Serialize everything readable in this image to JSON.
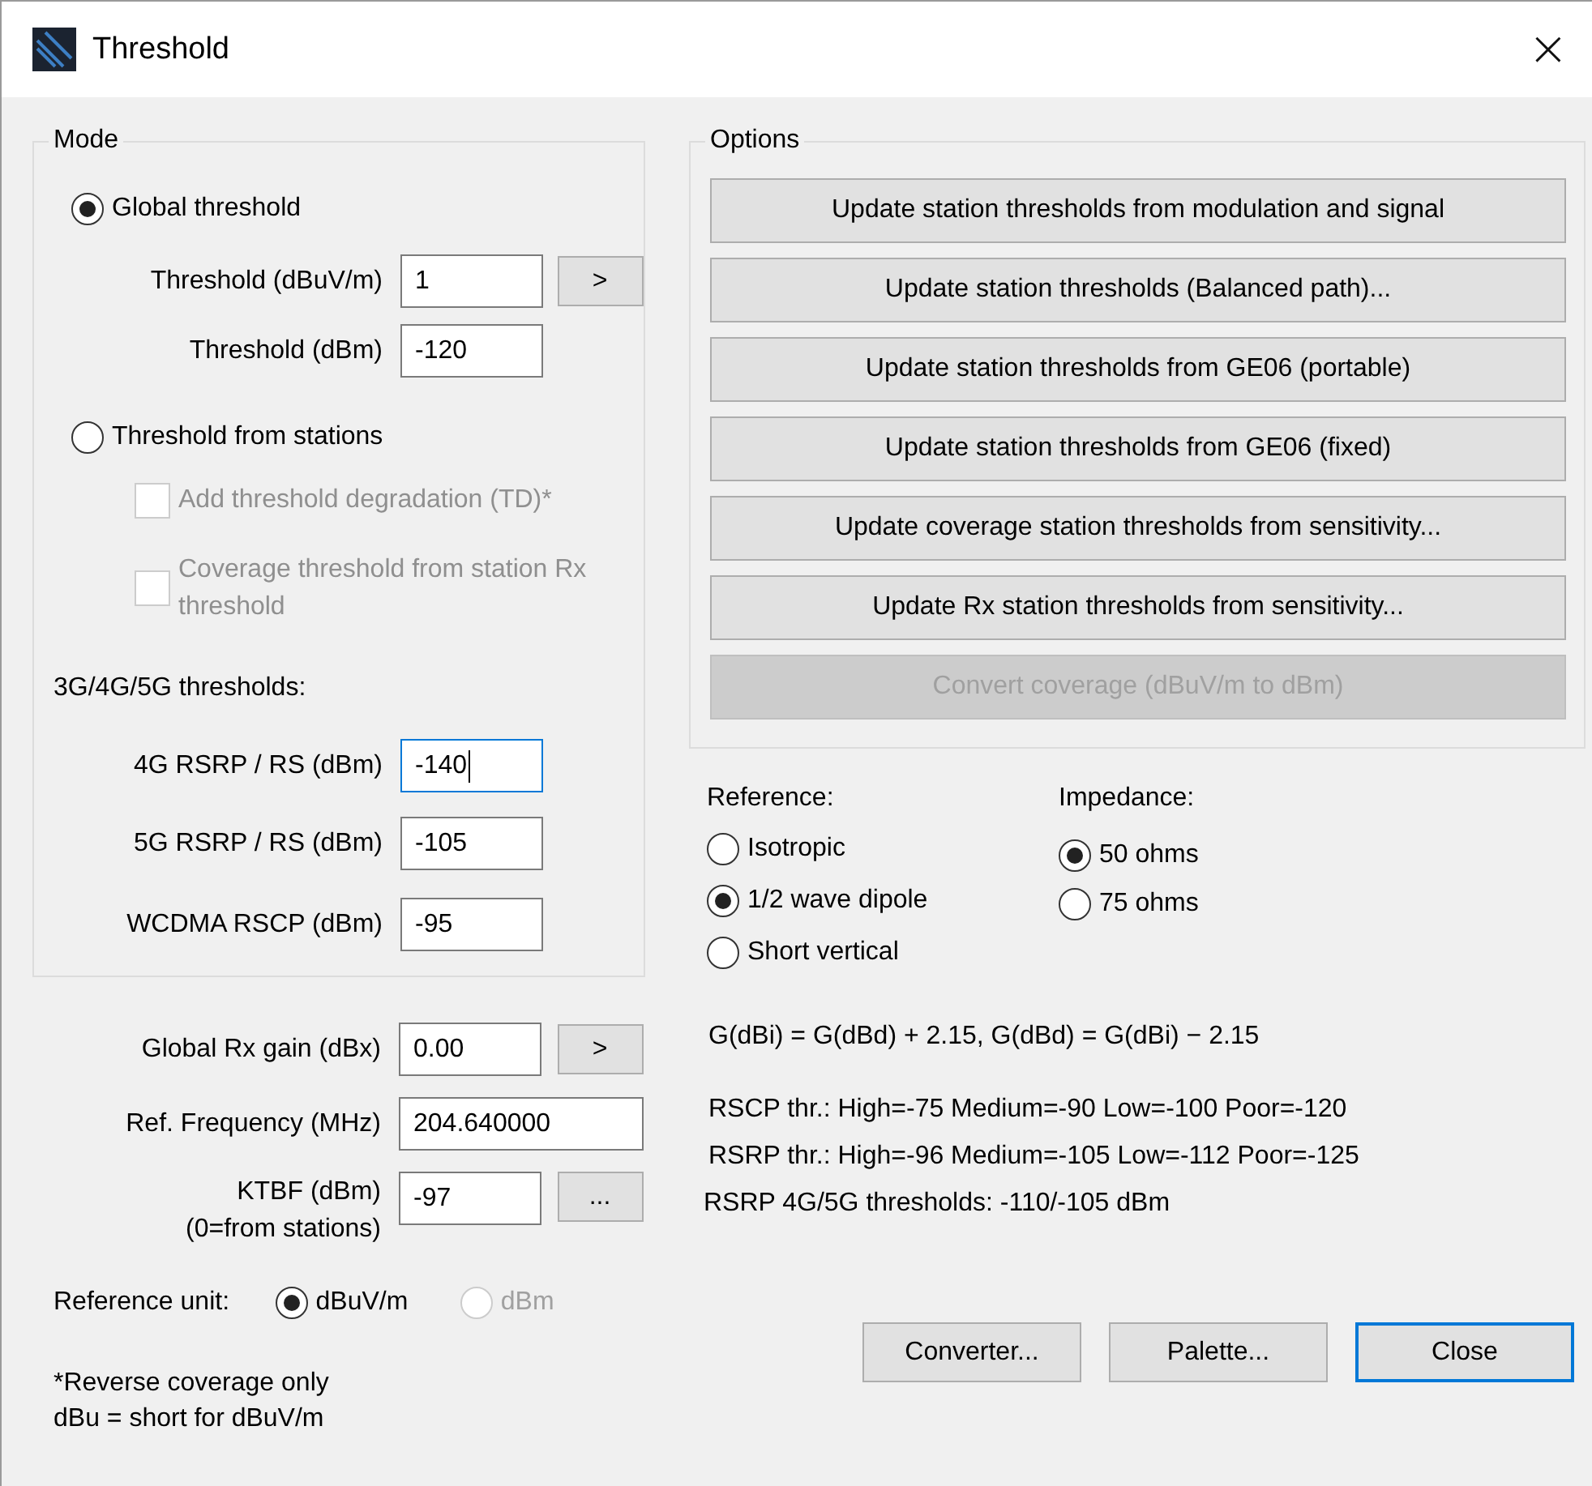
{
  "window": {
    "title": "Threshold",
    "close": "×"
  },
  "mode": {
    "title": "Mode",
    "global": {
      "label": "Global threshold",
      "selected": true
    },
    "global_fields": [
      {
        "label": "Threshold (dBuV/m)",
        "value": "1",
        "button": ">",
        "focused": false
      },
      {
        "label": "Threshold (dBm)",
        "value": "-120",
        "focused": false
      }
    ],
    "stations": {
      "label": "Threshold from stations",
      "selected": false
    },
    "station_checks": [
      {
        "label": "Add threshold degradation (TD)*",
        "checked": false,
        "disabled": true
      },
      {
        "label": "Coverage threshold from station Rx threshold",
        "checked": false,
        "disabled": true
      }
    ],
    "thresholds_title": "3G/4G/5G thresholds:",
    "threshold_fields": [
      {
        "label": "4G RSRP / RS (dBm)",
        "value": "-140",
        "focused": true
      },
      {
        "label": "5G RSRP / RS (dBm)",
        "value": "-105",
        "focused": false
      },
      {
        "label": "WCDMA RSCP (dBm)",
        "value": "-95",
        "focused": false
      }
    ]
  },
  "fields": [
    {
      "label": "Global Rx gain (dBx)",
      "value": "0.00",
      "button": ">",
      "kind": "short"
    },
    {
      "label": "Ref. Frequency (MHz)",
      "value": "204.640000",
      "kind": "wide"
    },
    {
      "label": "KTBF (dBm)\n(0=from stations)",
      "value": "-97",
      "button": "...",
      "kind": "short"
    }
  ],
  "reference_unit": {
    "label": "Reference unit:",
    "options": [
      {
        "label": "dBuV/m",
        "selected": true,
        "disabled": false
      },
      {
        "label": "dBm",
        "selected": false,
        "disabled": true
      }
    ]
  },
  "notes": [
    "*Reverse coverage only",
    "dBu = short for dBuV/m"
  ],
  "options": {
    "title": "Options",
    "buttons": [
      {
        "label": "Update station thresholds from modulation and signal",
        "disabled": false
      },
      {
        "label": "Update station thresholds (Balanced path)...",
        "disabled": false
      },
      {
        "label": "Update station thresholds from GE06 (portable)",
        "disabled": false
      },
      {
        "label": "Update station thresholds from GE06 (fixed)",
        "disabled": false
      },
      {
        "label": "Update coverage station thresholds from sensitivity...",
        "disabled": false
      },
      {
        "label": "Update Rx station thresholds from sensitivity...",
        "disabled": false
      },
      {
        "label": "Convert coverage (dBuV/m to dBm)",
        "disabled": true
      }
    ]
  },
  "reference": {
    "title": "Reference:",
    "options": [
      {
        "label": "Isotropic",
        "selected": false
      },
      {
        "label": "1/2 wave dipole",
        "selected": true
      },
      {
        "label": "Short vertical",
        "selected": false
      }
    ]
  },
  "impedance": {
    "title": "Impedance:",
    "options": [
      {
        "label": "50 ohms",
        "selected": true
      },
      {
        "label": "75 ohms",
        "selected": false
      }
    ]
  },
  "formula": "G(dBi) = G(dBd) + 2.15, G(dBd) = G(dBi) − 2.15",
  "info_lines": [
    "RSCP thr.: High=-75 Medium=-90 Low=-100 Poor=-120",
    "RSRP thr.: High=-96 Medium=-105 Low=-112 Poor=-125",
    "RSRP 4G/5G thresholds: -110/-105 dBm"
  ],
  "footer_buttons": [
    {
      "label": "Converter...",
      "default": false
    },
    {
      "label": "Palette...",
      "default": false
    },
    {
      "label": "Close",
      "default": true
    }
  ]
}
